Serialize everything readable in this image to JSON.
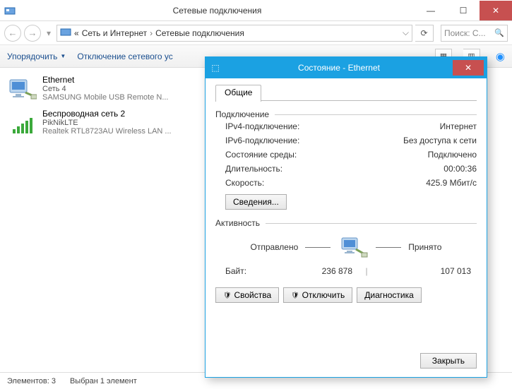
{
  "window": {
    "title": "Сетевые подключения",
    "search_placeholder": "Поиск: С..."
  },
  "breadcrumb": {
    "prefix": "«",
    "item1": "Сеть и Интернет",
    "item2": "Сетевые подключения"
  },
  "toolbar": {
    "organize": "Упорядочить",
    "disable": "Отключение сетевого ус"
  },
  "connections": [
    {
      "name": "Ethernet",
      "line2": "Сеть  4",
      "line3": "SAMSUNG Mobile USB Remote N..."
    },
    {
      "name": "Беспроводная сеть 2",
      "line2": "PikNikLTE",
      "line3": "Realtek RTL8723AU Wireless LAN ..."
    }
  ],
  "statusbar": {
    "count": "Элементов: 3",
    "selected": "Выбран 1 элемент"
  },
  "dialog": {
    "title": "Состояние - Ethernet",
    "tab": "Общие",
    "group_connection": "Подключение",
    "rows": {
      "ipv4_label": "IPv4-подключение:",
      "ipv4_value": "Интернет",
      "ipv6_label": "IPv6-подключение:",
      "ipv6_value": "Без доступа к сети",
      "media_label": "Состояние среды:",
      "media_value": "Подключено",
      "duration_label": "Длительность:",
      "duration_value": "00:00:36",
      "speed_label": "Скорость:",
      "speed_value": "425.9 Мбит/с"
    },
    "details_btn": "Сведения...",
    "group_activity": "Активность",
    "activity": {
      "sent_label": "Отправлено",
      "recv_label": "Принято",
      "bytes_label": "Байт:",
      "bytes_sent": "236 878",
      "bytes_recv": "107 013"
    },
    "buttons": {
      "properties": "Свойства",
      "disable": "Отключить",
      "diagnose": "Диагностика",
      "close": "Закрыть"
    }
  }
}
